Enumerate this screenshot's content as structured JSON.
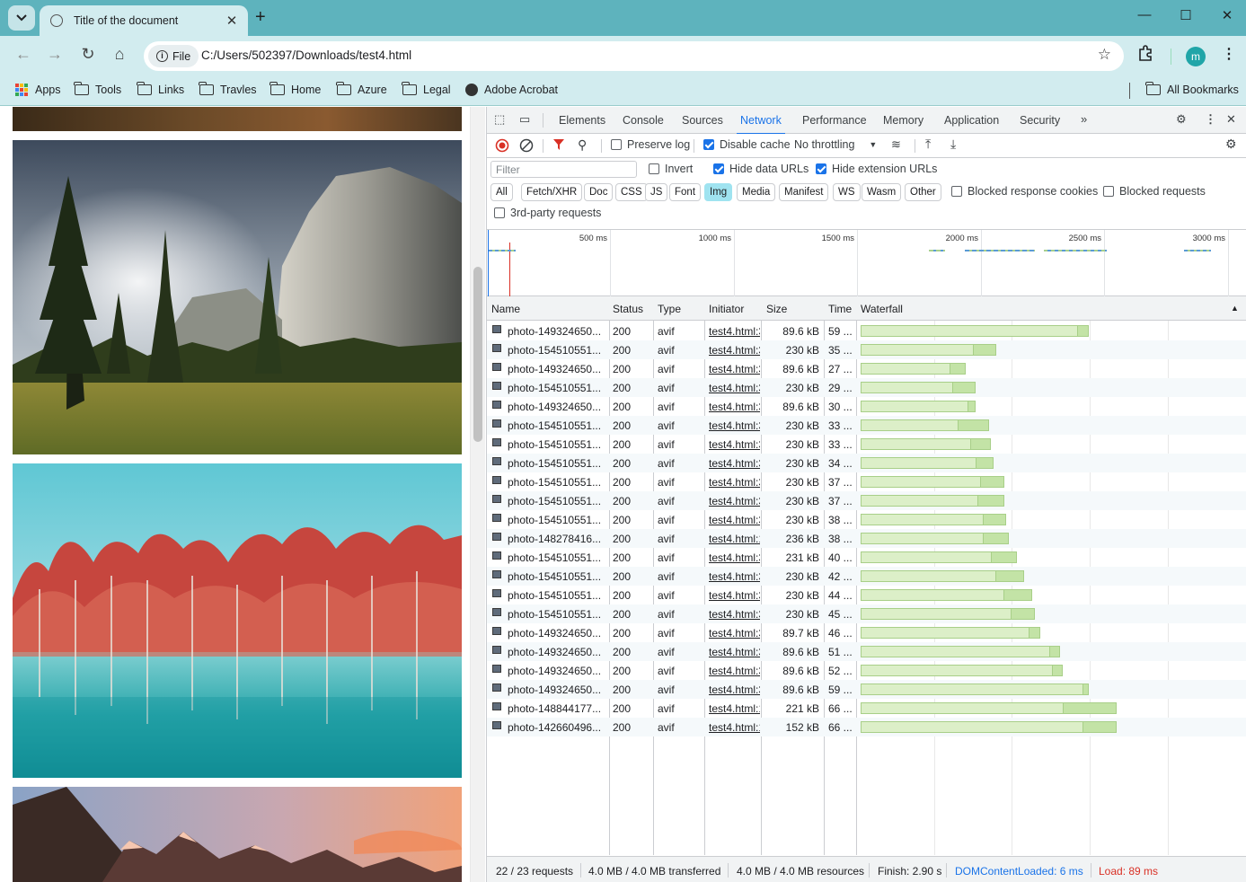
{
  "browser": {
    "tab_title": "Title of the document",
    "chip_label": "File",
    "url": "C:/Users/502397/Downloads/test4.html",
    "avatar_letter": "m",
    "bookmarks": [
      "Apps",
      "Tools",
      "Links",
      "Travles",
      "Home",
      "Azure",
      "Legal",
      "Adobe Acrobat"
    ],
    "all_bookmarks": "All Bookmarks"
  },
  "devtools": {
    "tabs": [
      "Elements",
      "Console",
      "Sources",
      "Network",
      "Performance",
      "Memory",
      "Application",
      "Security"
    ],
    "active_tab": "Network",
    "controls": {
      "preserve_log": "Preserve log",
      "disable_cache": "Disable cache",
      "throttling": "No throttling"
    },
    "filter": {
      "placeholder": "Filter",
      "invert": "Invert",
      "hide_data_urls": "Hide data URLs",
      "hide_extension_urls": "Hide extension URLs",
      "types": [
        "All",
        "Fetch/XHR",
        "Doc",
        "CSS",
        "JS",
        "Font",
        "Img",
        "Media",
        "Manifest",
        "WS",
        "Wasm",
        "Other"
      ],
      "selected_type": "Img",
      "blocked_cookies": "Blocked response cookies",
      "blocked_requests": "Blocked requests",
      "third_party": "3rd-party requests"
    },
    "timeline_labels": [
      "500 ms",
      "1000 ms",
      "1500 ms",
      "2000 ms",
      "2500 ms",
      "3000 ms"
    ],
    "columns": [
      "Name",
      "Status",
      "Type",
      "Initiator",
      "Size",
      "Time",
      "Waterfall"
    ],
    "rows": [
      {
        "name": "photo-149324650...",
        "status": "200",
        "type": "avif",
        "initiator": "test4.html:3",
        "size": "89.6 kB",
        "time": "59 ...",
        "start": 0.0,
        "wait": 0.85,
        "end": 0.89
      },
      {
        "name": "photo-154510551...",
        "status": "200",
        "type": "avif",
        "initiator": "test4.html:3",
        "size": "230 kB",
        "time": "35 ...",
        "start": 0.0,
        "wait": 0.44,
        "end": 0.53
      },
      {
        "name": "photo-149324650...",
        "status": "200",
        "type": "avif",
        "initiator": "test4.html:3",
        "size": "89.6 kB",
        "time": "27 ...",
        "start": 0.0,
        "wait": 0.35,
        "end": 0.41
      },
      {
        "name": "photo-154510551...",
        "status": "200",
        "type": "avif",
        "initiator": "test4.html:3",
        "size": "230 kB",
        "time": "29 ...",
        "start": 0.0,
        "wait": 0.36,
        "end": 0.45
      },
      {
        "name": "photo-149324650...",
        "status": "200",
        "type": "avif",
        "initiator": "test4.html:3",
        "size": "89.6 kB",
        "time": "30 ...",
        "start": 0.0,
        "wait": 0.42,
        "end": 0.45
      },
      {
        "name": "photo-154510551...",
        "status": "200",
        "type": "avif",
        "initiator": "test4.html:3",
        "size": "230 kB",
        "time": "33 ...",
        "start": 0.0,
        "wait": 0.38,
        "end": 0.5
      },
      {
        "name": "photo-154510551...",
        "status": "200",
        "type": "avif",
        "initiator": "test4.html:3",
        "size": "230 kB",
        "time": "33 ...",
        "start": 0.0,
        "wait": 0.43,
        "end": 0.51
      },
      {
        "name": "photo-154510551...",
        "status": "200",
        "type": "avif",
        "initiator": "test4.html:3",
        "size": "230 kB",
        "time": "34 ...",
        "start": 0.0,
        "wait": 0.45,
        "end": 0.52
      },
      {
        "name": "photo-154510551...",
        "status": "200",
        "type": "avif",
        "initiator": "test4.html:3",
        "size": "230 kB",
        "time": "37 ...",
        "start": 0.0,
        "wait": 0.47,
        "end": 0.56
      },
      {
        "name": "photo-154510551...",
        "status": "200",
        "type": "avif",
        "initiator": "test4.html:3",
        "size": "230 kB",
        "time": "37 ...",
        "start": 0.0,
        "wait": 0.46,
        "end": 0.56
      },
      {
        "name": "photo-154510551...",
        "status": "200",
        "type": "avif",
        "initiator": "test4.html:3",
        "size": "230 kB",
        "time": "38 ...",
        "start": 0.0,
        "wait": 0.48,
        "end": 0.57
      },
      {
        "name": "photo-148278416...",
        "status": "200",
        "type": "avif",
        "initiator": "test4.html:1",
        "size": "236 kB",
        "time": "38 ...",
        "start": 0.0,
        "wait": 0.48,
        "end": 0.58
      },
      {
        "name": "photo-154510551...",
        "status": "200",
        "type": "avif",
        "initiator": "test4.html:3",
        "size": "231 kB",
        "time": "40 ...",
        "start": 0.0,
        "wait": 0.51,
        "end": 0.61
      },
      {
        "name": "photo-154510551...",
        "status": "200",
        "type": "avif",
        "initiator": "test4.html:3",
        "size": "230 kB",
        "time": "42 ...",
        "start": 0.0,
        "wait": 0.53,
        "end": 0.64
      },
      {
        "name": "photo-154510551...",
        "status": "200",
        "type": "avif",
        "initiator": "test4.html:3",
        "size": "230 kB",
        "time": "44 ...",
        "start": 0.0,
        "wait": 0.56,
        "end": 0.67
      },
      {
        "name": "photo-154510551...",
        "status": "200",
        "type": "avif",
        "initiator": "test4.html:3",
        "size": "230 kB",
        "time": "45 ...",
        "start": 0.0,
        "wait": 0.59,
        "end": 0.68
      },
      {
        "name": "photo-149324650...",
        "status": "200",
        "type": "avif",
        "initiator": "test4.html:3",
        "size": "89.7 kB",
        "time": "46 ...",
        "start": 0.0,
        "wait": 0.66,
        "end": 0.7
      },
      {
        "name": "photo-149324650...",
        "status": "200",
        "type": "avif",
        "initiator": "test4.html:3",
        "size": "89.6 kB",
        "time": "51 ...",
        "start": 0.0,
        "wait": 0.74,
        "end": 0.78
      },
      {
        "name": "photo-149324650...",
        "status": "200",
        "type": "avif",
        "initiator": "test4.html:3",
        "size": "89.6 kB",
        "time": "52 ...",
        "start": 0.0,
        "wait": 0.75,
        "end": 0.79
      },
      {
        "name": "photo-149324650...",
        "status": "200",
        "type": "avif",
        "initiator": "test4.html:3",
        "size": "89.6 kB",
        "time": "59 ...",
        "start": 0.0,
        "wait": 0.87,
        "end": 0.89
      },
      {
        "name": "photo-148844177...",
        "status": "200",
        "type": "avif",
        "initiator": "test4.html:1",
        "size": "221 kB",
        "time": "66 ...",
        "start": 0.0,
        "wait": 0.79,
        "end": 1.0
      },
      {
        "name": "photo-142660496...",
        "status": "200",
        "type": "avif",
        "initiator": "test4.html:1",
        "size": "152 kB",
        "time": "66 ...",
        "start": 0.0,
        "wait": 0.87,
        "end": 1.0
      }
    ],
    "status_bar": {
      "requests": "22 / 23 requests",
      "transferred": "4.0 MB / 4.0 MB transferred",
      "resources": "4.0 MB / 4.0 MB resources",
      "finish": "Finish: 2.90 s",
      "dcl": "DOMContentLoaded: 6 ms",
      "load": "Load: 89 ms",
      "dcl_color": "#1a73e8",
      "load_color": "#d93025"
    }
  }
}
